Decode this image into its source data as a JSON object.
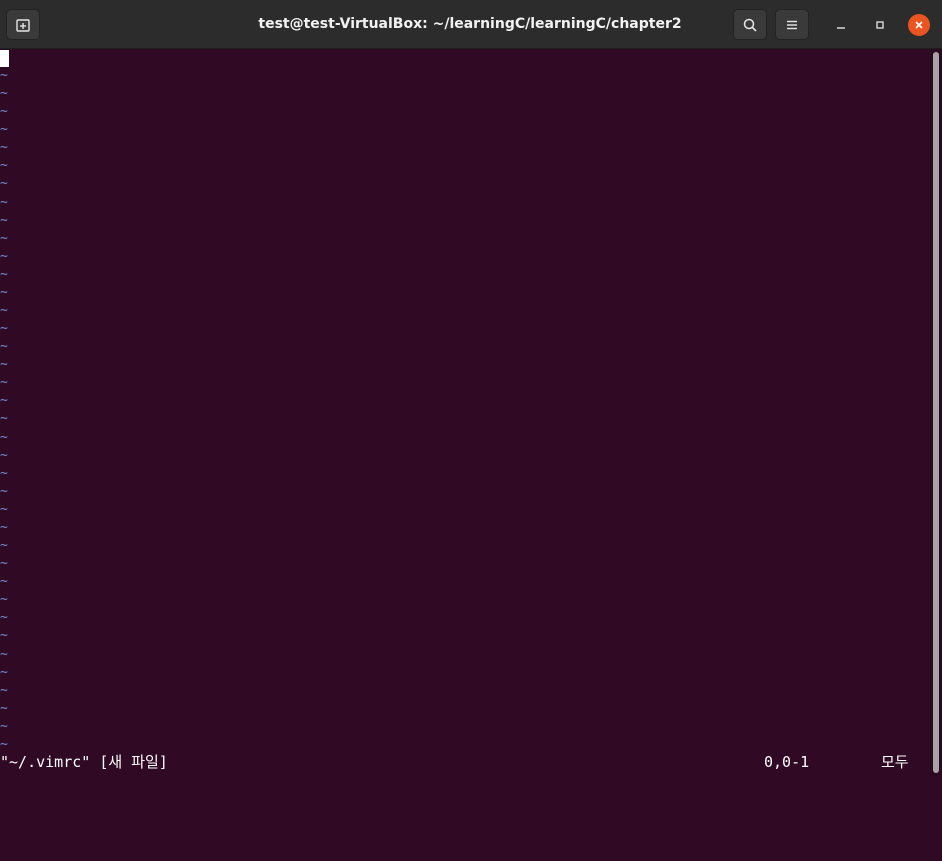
{
  "window": {
    "title": "test@test-VirtualBox: ~/learningC/learningC/chapter2"
  },
  "header": {
    "new_tab_icon": "new-tab-icon",
    "search_icon": "search-icon",
    "menu_icon": "hamburger-menu-icon",
    "minimize_icon": "minimize-icon",
    "maximize_icon": "maximize-icon",
    "close_icon": "close-icon"
  },
  "colors": {
    "terminal_bg": "#300a24",
    "header_bg": "#2c2c2c",
    "tilde": "#6f8fd6",
    "close_button": "#e95420"
  },
  "editor": {
    "empty_line_marker": "~",
    "empty_line_count": 38,
    "status": {
      "file": "\"~/.vimrc\" [새 파일]",
      "position": "0,0-1",
      "scroll": "모두"
    }
  }
}
